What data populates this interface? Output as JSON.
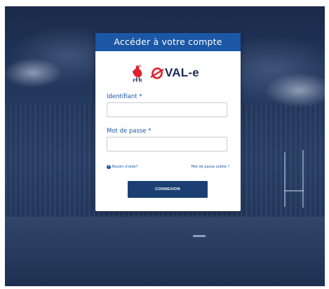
{
  "login": {
    "title": "Accéder à votre compte",
    "ffr_text": "FFR",
    "oval_text": "VAL-e",
    "identifier_label": "Identifiant *",
    "identifier_value": "",
    "password_label": "Mot de passe *",
    "password_value": "",
    "help_link": "Besoin d'aide?",
    "forgot_link": "Mot de passe oublié ?",
    "connect_button": "CONNEXION"
  },
  "colors": {
    "header_blue": "#1b57a5",
    "button_navy": "#1b3f73",
    "logo_red": "#e0202b",
    "logo_navy": "#1b2a55"
  },
  "icons": [
    "rooster-icon",
    "oval-ball-icon",
    "help-icon"
  ]
}
